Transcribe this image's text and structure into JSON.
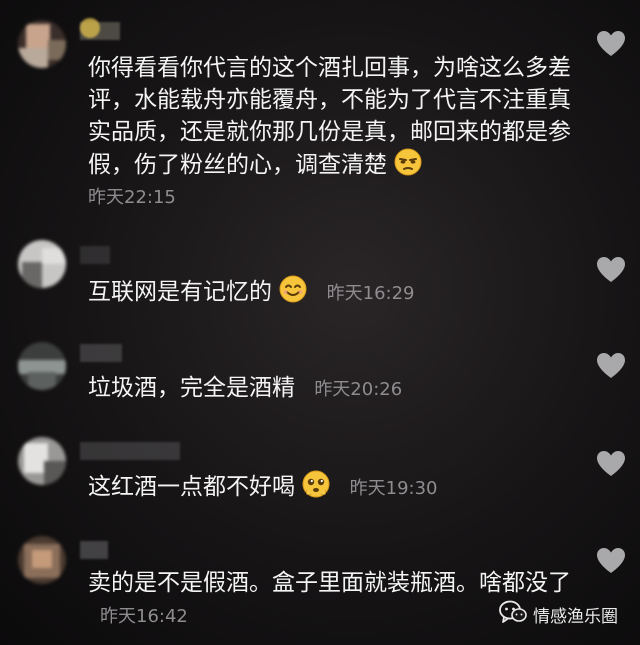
{
  "comments": [
    {
      "text": "你得看看你代言的这个酒扎回事，为啥这么多差评，水能载舟亦能覆舟，不能为了代言不注重真实品质，还是就你那几份是真，邮回来的都是参假，伤了粉丝的心，调查清楚",
      "emoji": "squint-face",
      "time": "昨天22:15"
    },
    {
      "text": "互联网是有记忆的",
      "emoji": "smile-face",
      "time": "昨天16:29"
    },
    {
      "text": "垃圾酒，完全是酒精",
      "emoji": "",
      "time": "昨天20:26"
    },
    {
      "text": "这红酒一点都不好喝",
      "emoji": "pleading-face",
      "time": "昨天19:30"
    },
    {
      "text": "卖的是不是假酒。盒子里面就装瓶酒。啥都没了",
      "emoji": "",
      "time": "昨天16:42"
    }
  ],
  "watermark": {
    "label": "情感渔乐圈",
    "icon": "wechat-icon"
  },
  "icons": {
    "like": "heart-icon"
  },
  "colors": {
    "text": "#f4f4f4",
    "time": "#8e8c8f",
    "heart": "#a9a9ab"
  }
}
